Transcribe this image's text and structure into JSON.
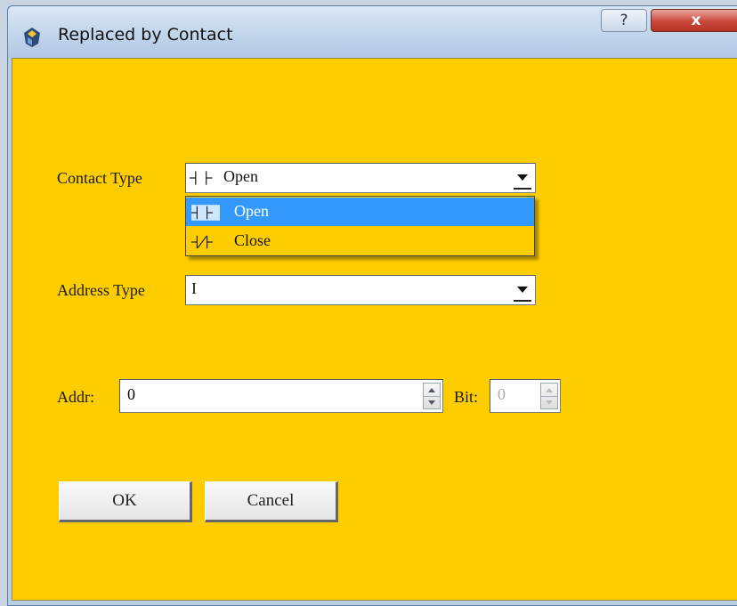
{
  "window": {
    "title": "Replaced by Contact",
    "help_label": "?",
    "close_label": "x"
  },
  "contact_type": {
    "label": "Contact Type",
    "selected": "Open",
    "options": [
      {
        "label": "Open",
        "icon": "normally-open-contact-icon",
        "selected": true
      },
      {
        "label": "Close",
        "icon": "normally-closed-contact-icon",
        "selected": false
      }
    ]
  },
  "address_type": {
    "label": "Address Type",
    "selected": "I"
  },
  "addr": {
    "label": "Addr:",
    "value": "0"
  },
  "bit": {
    "label": "Bit:",
    "value": "0",
    "enabled": false
  },
  "buttons": {
    "ok_label": "OK",
    "cancel_label": "Cancel"
  },
  "colors": {
    "dialog_background": "#fecd00",
    "selection": "#3399ff"
  }
}
